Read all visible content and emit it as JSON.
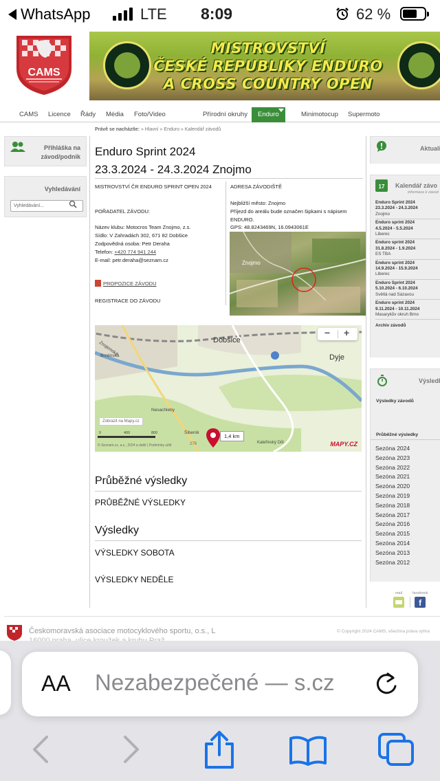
{
  "status_bar": {
    "back_app": "WhatsApp",
    "network": "LTE",
    "time": "8:09",
    "battery": "62 %"
  },
  "banner": {
    "line1": "MISTROVSTVÍ",
    "line2": "ČESKÉ REPUBLIKY ENDURO",
    "line3": "A CROSS COUNTRY OPEN"
  },
  "logo": {
    "text": "CAMS"
  },
  "nav": {
    "items": [
      "CAMS",
      "Licence",
      "Řády",
      "Média",
      "Foto/Video",
      "Přírodní okruhy",
      "Enduro",
      "Minimotocup",
      "Supermoto"
    ],
    "active": "Enduro"
  },
  "breadcrumb": {
    "label": "Právě se nacházíte:",
    "path": "» Hlavní » Enduro » Kalendář závodů"
  },
  "left_sidebar": {
    "login_title_1": "Přihláška na",
    "login_title_2": "závod/podnik",
    "search_title": "Vyhledávání",
    "search_placeholder": "Vyhledávání..."
  },
  "event": {
    "title": "Enduro Sprint 2024",
    "dates": "23.3.2024 - 24.3.2024 Znojmo",
    "championship": "MISTROVSTVÍ ČR ENDURO SPRINT OPEN 2024",
    "organizer_heading": "POŘADATEL ZÁVODU:",
    "club": "Název klubu: Motocros Team Znojmo, z.s.",
    "address": "Sídlo: V Zahradách 302, 671 82 Dobšice",
    "contact_person": "Zodpovědná osoba: Petr Deraha",
    "phone_label": "Telefon:",
    "phone": "+420 774 941 244",
    "email": "E-mail: petr.deraha@seznam.cz",
    "propozice": "PROPOZICE ZÁVODU",
    "registration": "REGISTRACE DO ZÁVODU",
    "venue_heading": "ADRESA ZÁVODIŠTĚ",
    "nearest_city": "Nejbližší město: Znojmo",
    "access_1": "Příjezd do areálu bude označen šipkami s nápisem",
    "access_2": "ENDURO.",
    "gps": "GPS: 48.8243469N, 16.0943061E",
    "sat_label": "Znojmo"
  },
  "map": {
    "labels": {
      "dobsice": "Dobšice",
      "dyje": "Dyje",
      "znojemska": "Znojemská",
      "bmenska": "Brněnská",
      "nesachleby": "Nesachleby",
      "sibenik": "Šibeník",
      "katerinsky": "Kateřinský Důl"
    },
    "show_on_mapy": "Zobrazit na Mapy.cz",
    "scale_0": "0",
    "scale_400": "400",
    "scale_800": "800",
    "distance": "1,4 km",
    "copyright": "© Seznam.cz, a.s., 2024 a další | Podmínky užití",
    "brand": "MAPY.CZ",
    "elevation": "279"
  },
  "results": {
    "interim_heading": "Průběžné výsledky",
    "interim_item": "PRŮBĚŽNÉ VÝSLEDKY",
    "results_heading": "Výsledky",
    "saturday": "VÝSLEDKY SOBOTA",
    "sunday": "VÝSLEDKY NEDĚLE"
  },
  "right_sidebar": {
    "news_title": "Aktuali",
    "calendar_title": "Kalendář závo",
    "calendar_subtitle": "informace k závod",
    "calendar_day": "17",
    "calendar": [
      {
        "name": "Enduro Sprint 2024",
        "dates": "23.3.2024 - 24.3.2024",
        "place": "Znojmo"
      },
      {
        "name": "Enduro sprint 2024",
        "dates": "4.5.2024 - 5.5.2024",
        "place": "Liberec"
      },
      {
        "name": "Enduro sprint 2024",
        "dates": "31.8.2024 - 1.9.2024",
        "place": "ES TBA"
      },
      {
        "name": "Enduro sprint 2024",
        "dates": "14.9.2024 - 15.9.2024",
        "place": "Liberec"
      },
      {
        "name": "Enduro Sprint 2024",
        "dates": "5.10.2024 - 6.10.2024",
        "place": "Světlá nad Sázavou"
      },
      {
        "name": "Enduro sprint 2024",
        "dates": "9.11.2024 - 10.11.2024",
        "place": "Masarykův okruh Brno"
      }
    ],
    "archive": "Archiv závodů",
    "results_title": "Výsledky",
    "results_races": "Výsledky závodů",
    "interim": "Průběžné výsledky",
    "seasons": [
      "Sezóna 2024",
      "Sezóna 2023",
      "Sezóna 2022",
      "Sezóna 2021",
      "Sezóna 2020",
      "Sezóna 2019",
      "Sezóna 2018",
      "Sezóna 2017",
      "Sezóna 2016",
      "Sezóna 2015",
      "Sezóna 2014",
      "Sezóna 2013",
      "Sezóna 2012"
    ],
    "mail_label": "mail",
    "facebook_label": "facebook"
  },
  "footer": {
    "org": "Českomoravská asociace motocyklového sportu, o.s., L",
    "org_line2": "16000 praha, ulice kroužek a kruhu Praž",
    "copyright": "© Copyright 2024 CAMS, všechna práva vyhra"
  },
  "safari": {
    "aa": "AA",
    "address": "Nezabezpečené — s.cz"
  },
  "colors": {
    "nav_active": "#3a8e3a",
    "ios_blue": "#1a73e8",
    "map_pin": "#c8102e"
  }
}
